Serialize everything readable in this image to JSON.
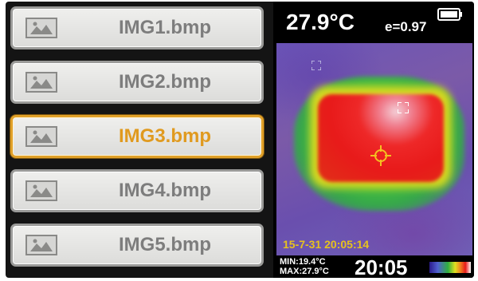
{
  "file_list": {
    "items": [
      {
        "label": "IMG1.bmp",
        "selected": false
      },
      {
        "label": "IMG2.bmp",
        "selected": false
      },
      {
        "label": "IMG3.bmp",
        "selected": true
      },
      {
        "label": "IMG4.bmp",
        "selected": false
      },
      {
        "label": "IMG5.bmp",
        "selected": false
      }
    ],
    "icon": "image-thumbnail-icon",
    "selected_color": "#e09a1f",
    "text_color": "#7d7d7d"
  },
  "thermal_view": {
    "center_temperature": "27.9°C",
    "emissivity": "e=0.97",
    "battery_icon": "battery-icon",
    "timestamp": "15-7-31 20:05:14",
    "min_temp": "MIN:19.4°C",
    "max_temp": "MAX:27.9°C",
    "clock": "20:05",
    "palette": "rainbow",
    "icons": [
      "corner-marker-icon",
      "hot-spot-marker-icon",
      "crosshair-icon"
    ]
  }
}
